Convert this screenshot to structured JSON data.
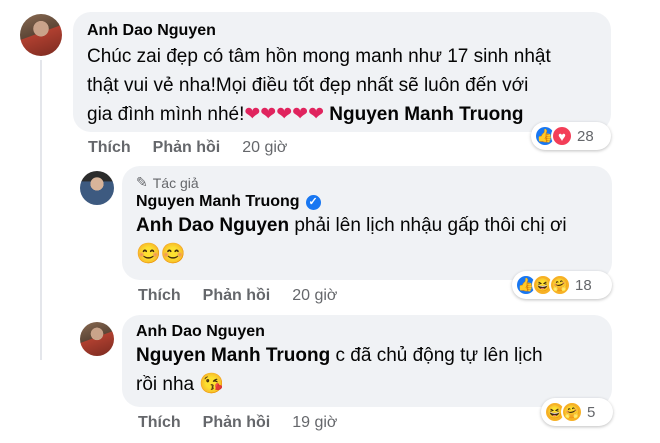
{
  "comments": [
    {
      "author": "Anh Dao Nguyen",
      "text_line1": "Chúc zai đẹp có tâm hồn mong manh như 17 sinh nhật",
      "text_line2": "thật vui vẻ nha!Mọi điều tốt đẹp nhất sẽ luôn đến với",
      "text_line3": "gia đình mình nhé!",
      "hearts": "❤❤❤❤❤",
      "mention": "Nguyen Manh Truong",
      "like_label": "Thích",
      "reply_label": "Phản hồi",
      "time": "20 giờ",
      "reaction_count": "28"
    },
    {
      "author_tag": "Tác giả",
      "author": "Nguyen Manh Truong",
      "verified_mark": "✓",
      "mention": "Anh Dao Nguyen",
      "text_line1": "phải lên lịch nhậu gấp thôi chị ơi",
      "emojis": "😊😊",
      "like_label": "Thích",
      "reply_label": "Phản hồi",
      "time": "20 giờ",
      "reaction_count": "18"
    },
    {
      "author": "Anh Dao Nguyen",
      "mention": "Nguyen Manh Truong",
      "text_line1": "c đã chủ động tự lên lịch",
      "text_line2": "rồi nha",
      "emoji": "😘",
      "like_label": "Thích",
      "reply_label": "Phản hồi",
      "time": "19 giờ",
      "reaction_count": "5"
    }
  ],
  "icons": {
    "like": "👍",
    "love": "♥",
    "haha": "😆",
    "care": "🤗",
    "pencil": "✎"
  }
}
